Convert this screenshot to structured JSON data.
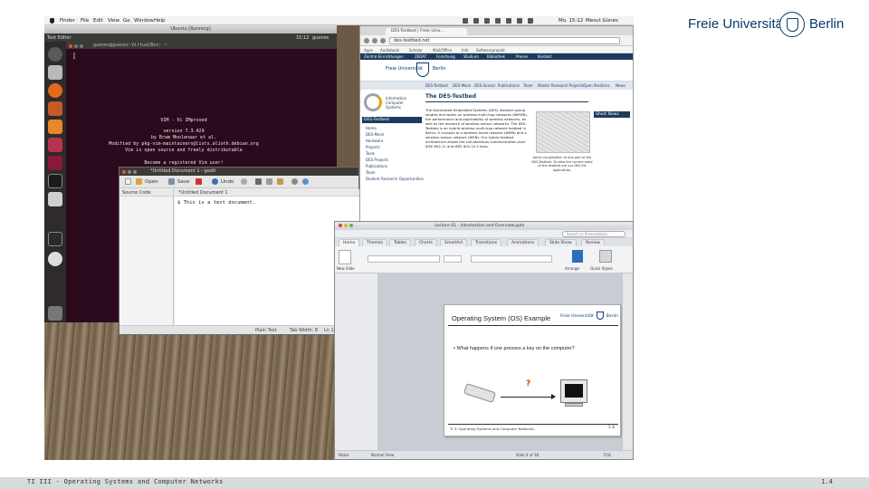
{
  "logo": {
    "left_text": "Freie Universität",
    "right_text": "Berlin"
  },
  "footer": {
    "left": "TI III - Operating Systems and Computer Networks",
    "right": "1.4"
  },
  "mac_menubar": {
    "items": [
      "Finder",
      "File",
      "Edit",
      "View",
      "Go",
      "Window",
      "Help"
    ],
    "clock": "Mo. 15:12",
    "user": "Mesut Günes"
  },
  "vm": {
    "window_title": "Ubuntu [Running]",
    "panel_left": "Text Editor",
    "panel_right_time": "15:12",
    "panel_right_user": "guenes",
    "terminal_title": "guenes@guenes-VirtualBox: ~",
    "cursor": "[",
    "vim_lines": [
      "VIM - Vi IMproved",
      "version 7.3.429",
      "by Bram Moolenaar et al.",
      "Modified by pkg-vim-maintainers@lists.alioth.debian.org",
      "Vim is open source and freely distributable",
      "Become a registered Vim user!",
      "type  :help register<Enter>   for information"
    ],
    "tildes": [
      "~",
      "~",
      "~",
      "~",
      "~",
      "~",
      "~"
    ]
  },
  "gedit": {
    "title": "*Untitled Document 1 - gedit",
    "toolbar": {
      "open": "Open",
      "save": "Save",
      "undo": "Undo"
    },
    "side_panel_header": "Source Code",
    "tab_label": "*Untitled Document 1",
    "text": "$ This is a text document.",
    "status": {
      "format": "Plain Text",
      "tab_width": "Tab Width: 8",
      "position": "Ln 1, Col 25"
    }
  },
  "browser": {
    "tab_title": "DES-Testbed | Freie Univ...",
    "url": "des-testbed.net",
    "bookmarks": [
      "Apps",
      "Audiobook",
      "Scholar",
      "Mail/Office",
      "Info",
      "Softwareprojekt"
    ],
    "fu_links": [
      "Zentral Einrichtungen",
      "ZEDAT",
      "Forschung",
      "Studium",
      "Bibliothek",
      "Presse",
      "Kontakt"
    ],
    "fu_logo_left": "Freie Universität",
    "fu_logo_right": "Berlin",
    "menu": [
      "DES-Testbed",
      "DES-Mesh",
      "DES-Sensor",
      "Publications",
      "Team",
      "Master Research Projects",
      "Open Positions",
      "News"
    ],
    "side_logo_text": [
      "Information",
      "Computer Systems"
    ],
    "side_header": "DES-Testbed",
    "side_items": [
      "Home",
      "DES-Mesh",
      "Hardware",
      "Projects",
      "Tools",
      "DES Projects",
      "Publications",
      "Team",
      "Student Research Opportunities"
    ],
    "page_heading": "The DES-Testbed",
    "intro": "The Distributed Embedded Systems (DES) research group studies and works on wireless multi-hop networks (WMHN), the performance and applicability of wireless networks, as well as the research of wireless sensor networks. The DES-Testbed is an hybrid wireless multi-hop network testbed in Berlin. It consists of a wireless mesh network (WMN) and a wireless sensor network (WSN). Our hybrid testbed architecture allows the simultaneous communication over IEEE 802.11 and IEEE 802.15.4 links.",
    "map_caption": "Aerial visualization of one part of the DES-Testbed. To view the current state of the testbed use our DES-Vis application.",
    "news_header": "Short News"
  },
  "ppt": {
    "title": "Lecture 01 - Introduction and Overview.pptx",
    "search_placeholder": "Search in Presentation",
    "tabs": [
      "Home",
      "Themes",
      "Tables",
      "Charts",
      "SmartArt",
      "Transitions",
      "Animations",
      "Slide Show",
      "Review"
    ],
    "ribbon_labels": {
      "new_slide": "New Slide",
      "arrange": "Arrange",
      "quick_styles": "Quick Styles"
    },
    "slide": {
      "title": "Operating System (OS) Example",
      "logo_left": "Freie Universität",
      "logo_right": "Berlin",
      "bullet": "What happens if one presses a key on the computer?",
      "question_mark": "?",
      "footer": "TI 3: Operating Systems and Computer Networks",
      "page": "1.4"
    },
    "notes_label": "Notes",
    "status": {
      "view": "Normal View",
      "slide_info": "Slide 4 of 38",
      "zoom": "72%"
    }
  }
}
